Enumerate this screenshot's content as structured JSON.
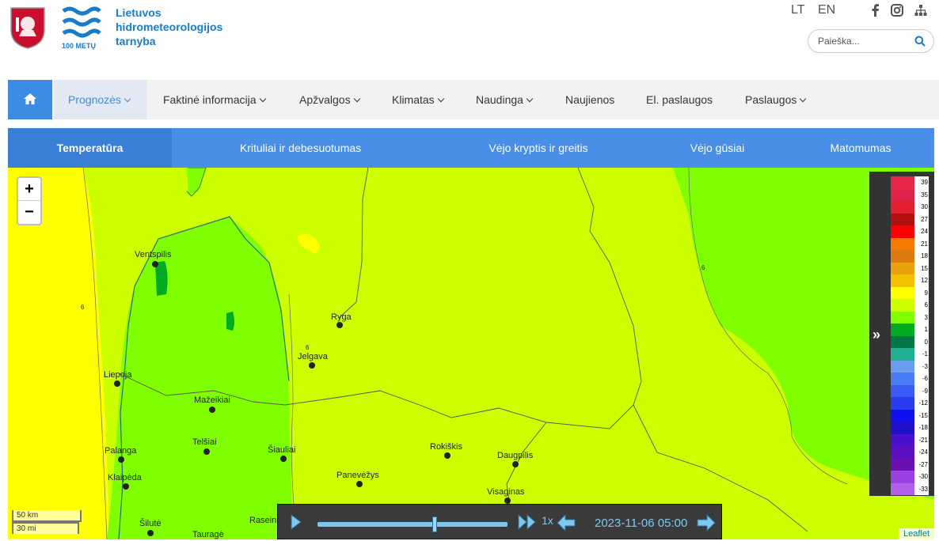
{
  "header": {
    "logo_years": "100 METŲ",
    "brand_lines": [
      "Lietuvos",
      "hidrometeorologijos",
      "tarnyba"
    ],
    "languages": [
      "LT",
      "EN"
    ],
    "social_icons": [
      "facebook-icon",
      "instagram-icon",
      "sitemap-icon"
    ],
    "search_placeholder": "Paieška..."
  },
  "nav": {
    "items": [
      {
        "label": "Prognozės",
        "dropdown": true,
        "active": true
      },
      {
        "label": "Faktinė informacija",
        "dropdown": true
      },
      {
        "label": "Apžvalgos",
        "dropdown": true
      },
      {
        "label": "Klimatas",
        "dropdown": true
      },
      {
        "label": "Naudinga",
        "dropdown": true
      },
      {
        "label": "Naujienos",
        "dropdown": false
      },
      {
        "label": "El. paslaugos",
        "dropdown": false
      },
      {
        "label": "Paslaugos",
        "dropdown": true
      }
    ]
  },
  "tabs": [
    "Temperatūra",
    "Krituliai ir debesuotumas",
    "Vėjo kryptis ir greitis",
    "Vėjo gūsiai",
    "Matomumas"
  ],
  "map": {
    "zoom_in": "+",
    "zoom_out": "−",
    "cities": [
      "Ventspilis",
      "Ryga",
      "Jelgava",
      "Liepoja",
      "Mažeikiai",
      "Telšiai",
      "Šiauliai",
      "Palanga",
      "Klaipėda",
      "Rokiškis",
      "Daugpilis",
      "Panevėžys",
      "Visaginas",
      "Šilutė",
      "Tauragė",
      "Raseiniai"
    ],
    "isoline_label": "6",
    "scale_km": "50 km",
    "scale_mi": "30 mi",
    "attribution": "Leaflet"
  },
  "legend": {
    "labels": [
      "39",
      "35",
      "30",
      "27",
      "24",
      "21",
      "18",
      "15",
      "12",
      "9",
      "6",
      "3",
      "1",
      "0",
      "-1",
      "-3",
      "-6",
      "-9",
      "-12",
      "-15",
      "-18",
      "-21",
      "-24",
      "-27",
      "-30",
      "-33"
    ],
    "colors": [
      "#e8264a",
      "#e0234a",
      "#e4202e",
      "#b01010",
      "#ff0000",
      "#f57a00",
      "#dd7a10",
      "#e8a20c",
      "#f2c200",
      "#ffff00",
      "#ccff00",
      "#80ff00",
      "#00aa22",
      "#007744",
      "#20b090",
      "#6a9cf0",
      "#4a7cf5",
      "#3a5cf5",
      "#2a3cf0",
      "#1010ee",
      "#2010cc",
      "#4a10cc",
      "#5a10c0",
      "#6a10b0",
      "#9a40e0",
      "#b060e8"
    ]
  },
  "player": {
    "speed": "1x",
    "datetime": "2023-11-06 05:00"
  }
}
